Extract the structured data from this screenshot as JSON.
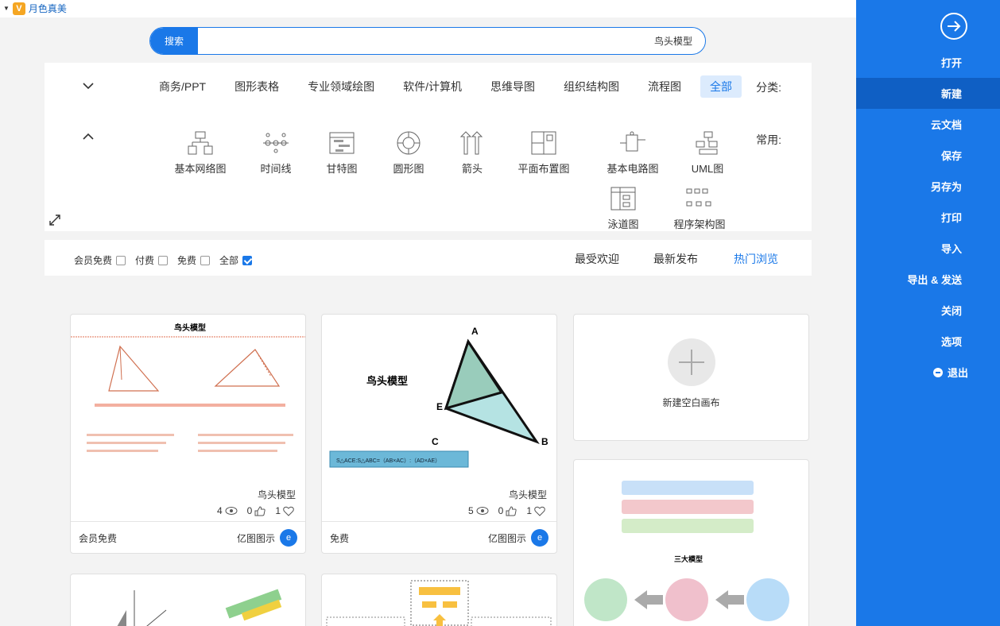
{
  "app": {
    "brand": "月色真美"
  },
  "search": {
    "button_label": "搜索",
    "value": "鸟头模型"
  },
  "categories": {
    "label": "分类:",
    "items": [
      "全部",
      "流程图",
      "组织结构图",
      "思维导图",
      "软件/计算机",
      "专业领域绘图",
      "图形表格",
      "商务/PPT"
    ],
    "active": "全部"
  },
  "common": {
    "label": "常用:",
    "templates": [
      "UML图",
      "基本电路图",
      "平面布置图",
      "箭头",
      "圆形图",
      "甘特图",
      "时间线",
      "基本网络图",
      "程序架构图",
      "泳道图"
    ]
  },
  "sort": {
    "items": [
      "热门浏览",
      "最新发布",
      "最受欢迎"
    ],
    "active": "热门浏览"
  },
  "filters": {
    "items": [
      "全部",
      "免费",
      "付费",
      "会员免费"
    ],
    "checked": "全部"
  },
  "cards": {
    "new_blank": "新建空白画布",
    "card1": {
      "title": "鸟头模型",
      "views": "5",
      "likes": "0",
      "favs": "1",
      "author": "亿图图示",
      "price": "免费",
      "labels": {
        "a": "A",
        "b": "B",
        "c": "C",
        "e": "E",
        "caption": "鸟头模型",
        "formula": "S△ACE:S△ABC=（AB×AC）:（AD×AE）"
      }
    },
    "card2": {
      "title": "鸟头模型",
      "views": "4",
      "likes": "0",
      "favs": "1",
      "author": "亿图图示",
      "price": "会员免费",
      "header": "鸟头模型"
    },
    "card3": {
      "title": "三大模型"
    }
  },
  "sidebar": {
    "items": [
      "打开",
      "新建",
      "云文档",
      "保存",
      "另存为",
      "打印",
      "导入",
      "导出 & 发送",
      "关闭",
      "选项",
      "退出"
    ],
    "active": "新建"
  },
  "colors": {
    "accent": "#1a78e8",
    "sidebar_active": "#0f5fc4"
  }
}
